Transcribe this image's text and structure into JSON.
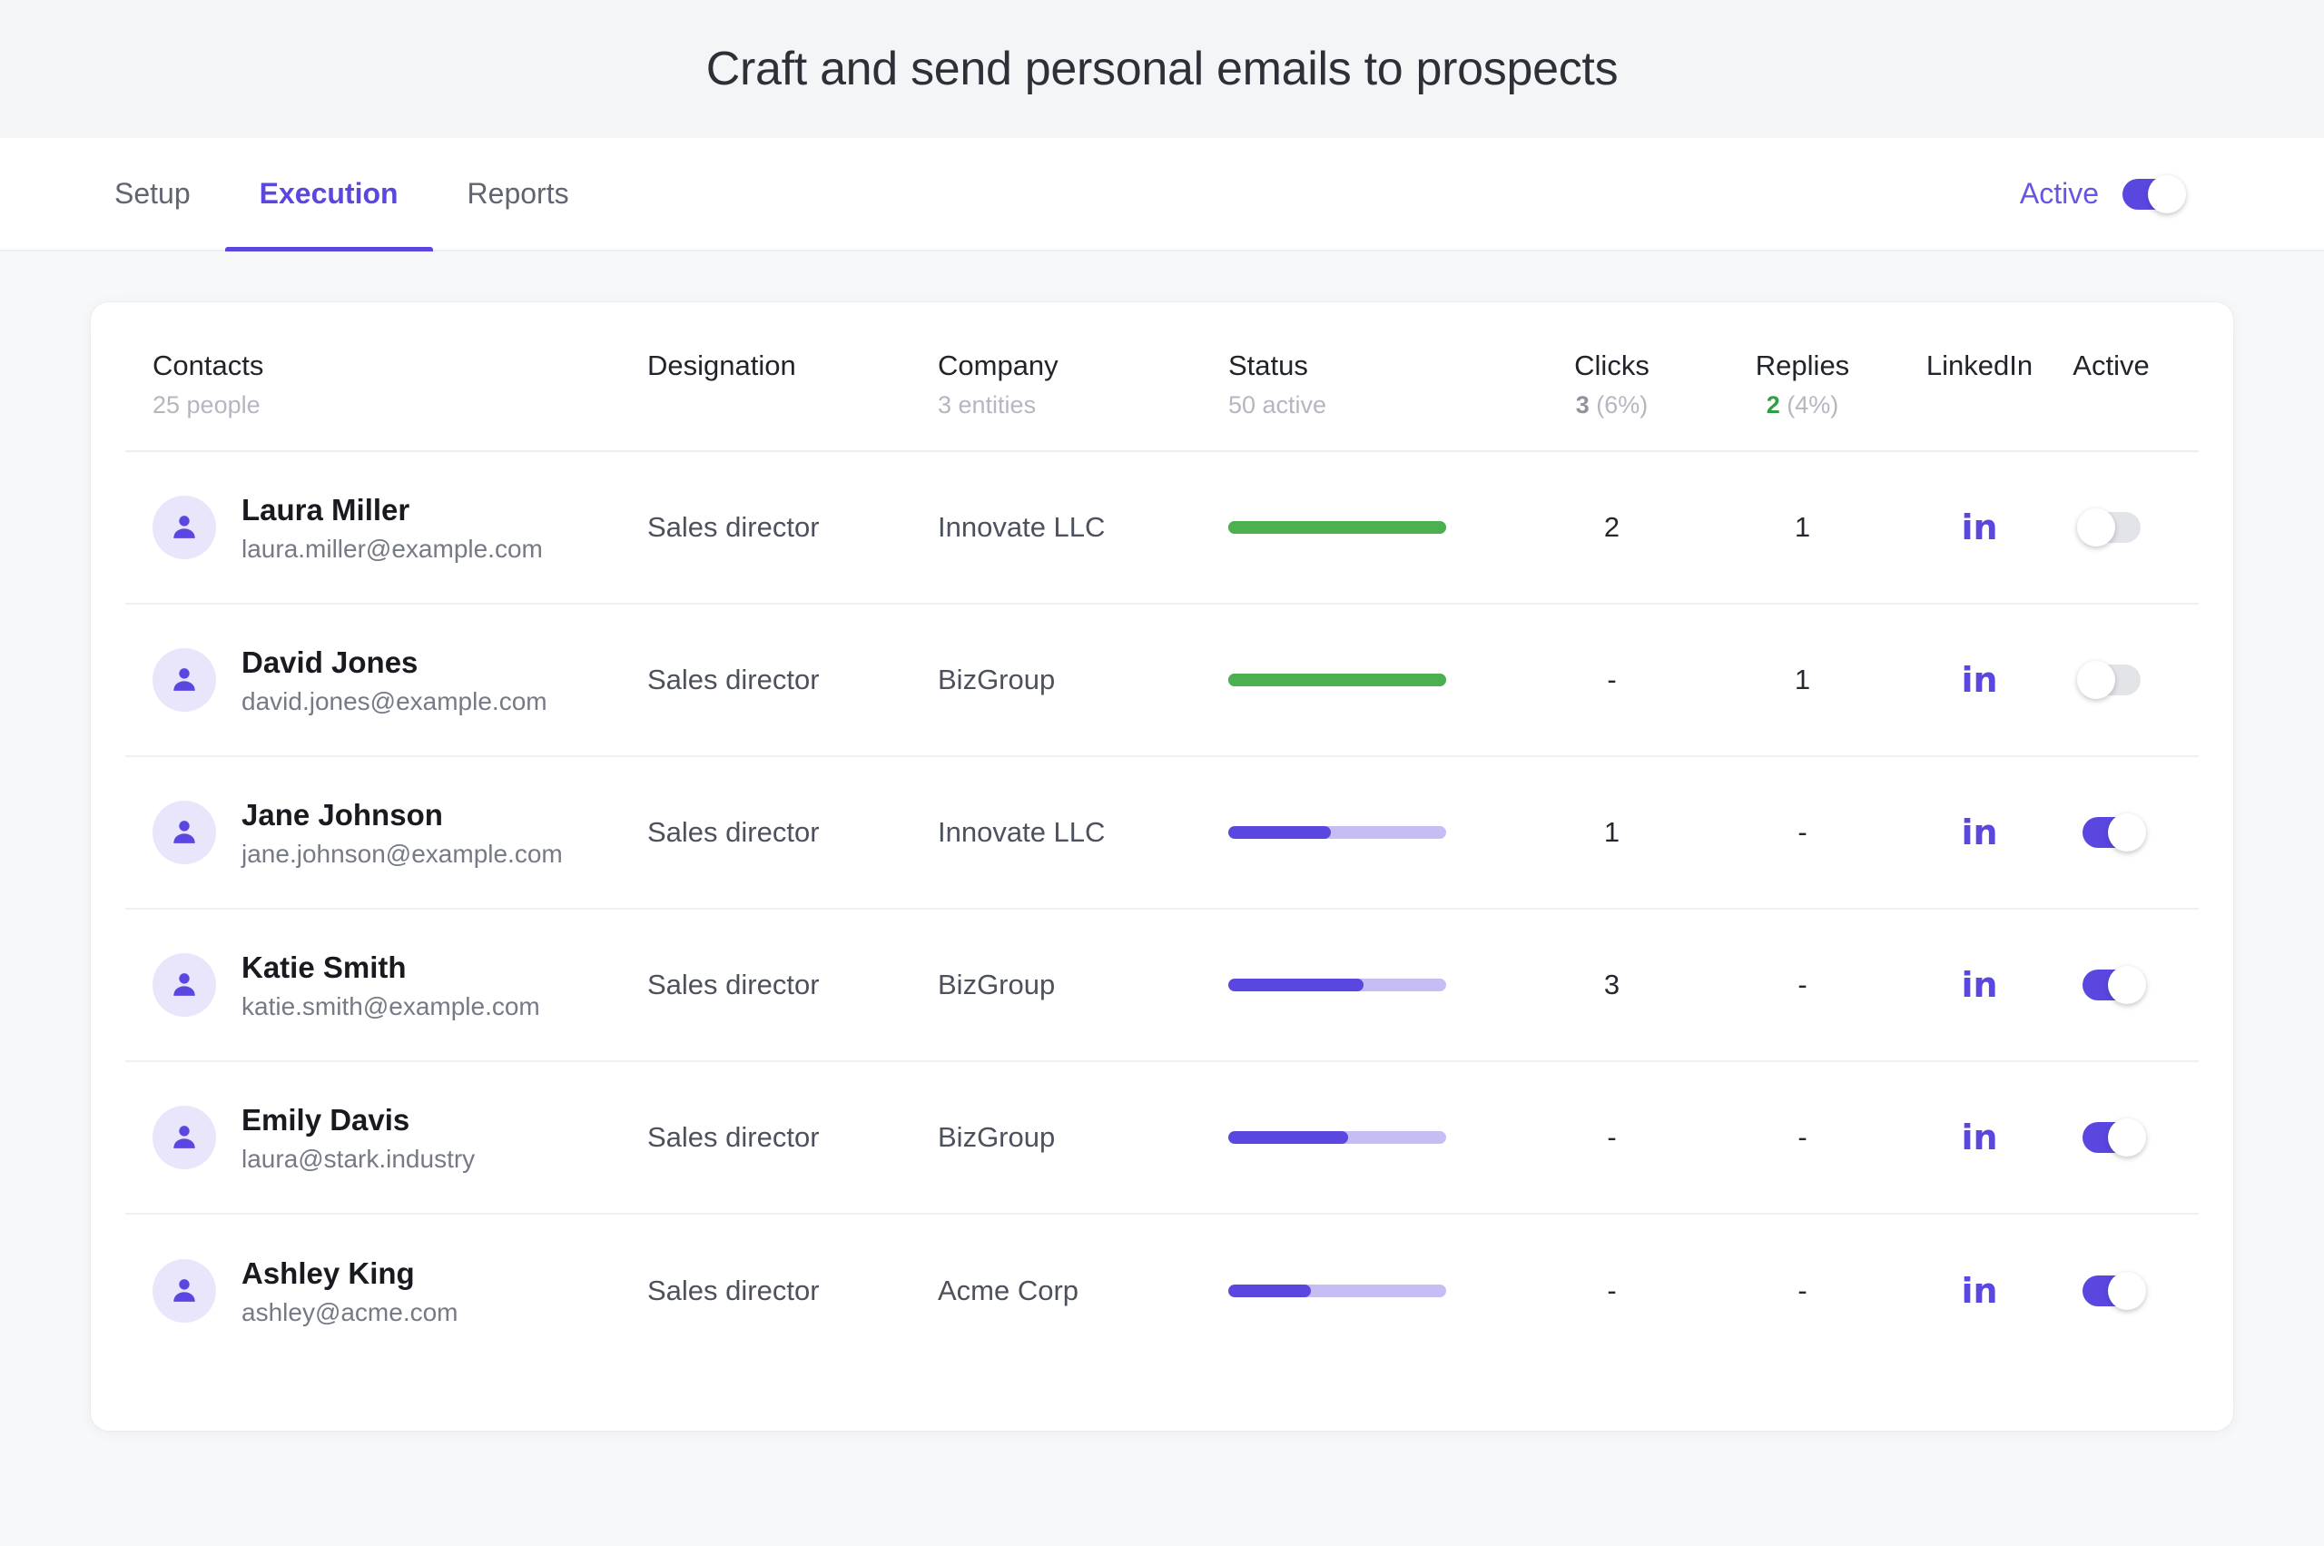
{
  "header": {
    "title": "Craft and send personal emails to prospects"
  },
  "tabs": [
    {
      "label": "Setup",
      "active": false
    },
    {
      "label": "Execution",
      "active": true
    },
    {
      "label": "Reports",
      "active": false
    }
  ],
  "toolbar": {
    "active_label": "Active",
    "active_state": "on"
  },
  "colors": {
    "accent": "#5a47e0",
    "accent_light": "#c5bdf3",
    "success": "#4caf50",
    "success_text": "#2f9e44",
    "page_bg": "#f7f8fa",
    "header_bg": "#f4f5f7",
    "card_bg": "#ffffff",
    "muted": "#b4b7bf"
  },
  "table": {
    "columns": {
      "contacts": {
        "title": "Contacts",
        "sub": "25 people"
      },
      "designation": {
        "title": "Designation",
        "sub": ""
      },
      "company": {
        "title": "Company",
        "sub": "3 entities"
      },
      "status": {
        "title": "Status",
        "sub": "50 active"
      },
      "clicks": {
        "title": "Clicks",
        "sub_value": "3",
        "sub_pct": "(6%)"
      },
      "replies": {
        "title": "Replies",
        "sub_value": "2",
        "sub_pct": "(4%)"
      },
      "linkedin": {
        "title": "LinkedIn",
        "sub": ""
      },
      "active": {
        "title": "Active",
        "sub": ""
      }
    },
    "rows": [
      {
        "name": "Laura Miller",
        "email": "laura.miller@example.com",
        "designation": "Sales director",
        "company": "Innovate LLC",
        "progress": 100,
        "progress_state": "complete",
        "clicks": "2",
        "replies": "1",
        "linkedin": "in",
        "active": "off"
      },
      {
        "name": "David Jones",
        "email": "david.jones@example.com",
        "designation": "Sales director",
        "company": "BizGroup",
        "progress": 100,
        "progress_state": "complete",
        "clicks": "-",
        "replies": "1",
        "linkedin": "in",
        "active": "off"
      },
      {
        "name": "Jane Johnson",
        "email": "jane.johnson@example.com",
        "designation": "Sales director",
        "company": "Innovate LLC",
        "progress": 47,
        "progress_state": "in-progress",
        "clicks": "1",
        "replies": "-",
        "linkedin": "in",
        "active": "on"
      },
      {
        "name": "Katie Smith",
        "email": "katie.smith@example.com",
        "designation": "Sales director",
        "company": "BizGroup",
        "progress": 62,
        "progress_state": "in-progress",
        "clicks": "3",
        "replies": "-",
        "linkedin": "in",
        "active": "on"
      },
      {
        "name": "Emily Davis",
        "email": "laura@stark.industry",
        "designation": "Sales director",
        "company": "BizGroup",
        "progress": 55,
        "progress_state": "in-progress",
        "clicks": "-",
        "replies": "-",
        "linkedin": "in",
        "active": "on"
      },
      {
        "name": "Ashley King",
        "email": "ashley@acme.com",
        "designation": "Sales director",
        "company": "Acme Corp",
        "progress": 38,
        "progress_state": "in-progress",
        "clicks": "-",
        "replies": "-",
        "linkedin": "in",
        "active": "on"
      }
    ]
  }
}
